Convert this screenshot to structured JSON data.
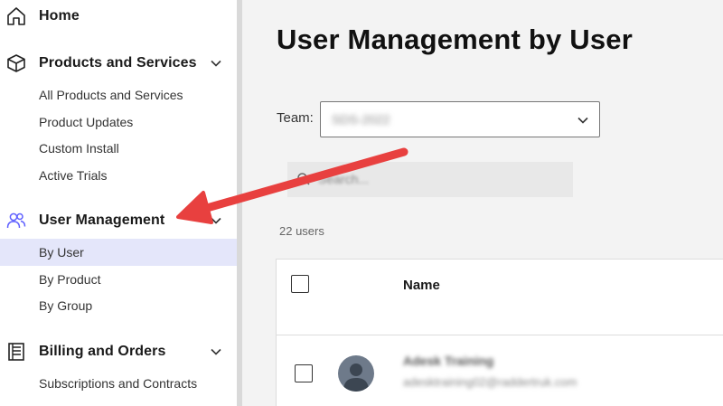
{
  "sidebar": {
    "home": {
      "label": "Home",
      "icon": "home-icon"
    },
    "products": {
      "label": "Products and Services",
      "icon": "cube-icon",
      "items": [
        "All Products and Services",
        "Product Updates",
        "Custom Install",
        "Active Trials"
      ]
    },
    "users": {
      "label": "User Management",
      "icon": "users-icon",
      "items": [
        "By User",
        "By Product",
        "By Group"
      ],
      "active_item": "By User"
    },
    "billing": {
      "label": "Billing and Orders",
      "icon": "ledger-icon",
      "items": [
        "Subscriptions and Contracts"
      ]
    }
  },
  "main": {
    "title": "User Management by User",
    "team": {
      "label": "Team:",
      "value": "SDS-2022"
    },
    "search": {
      "placeholder": "Search..."
    },
    "count": "22 users",
    "table": {
      "columns": [
        "Name"
      ],
      "rows": [
        {
          "name": "Adesk Training",
          "email": "adesktraining02@raddertruk.com"
        }
      ]
    }
  },
  "colors": {
    "accent": "#5f60ff",
    "active_bg": "#e4e6fa",
    "arrow": "#e8403f",
    "main_bg": "#f3f3f3"
  }
}
